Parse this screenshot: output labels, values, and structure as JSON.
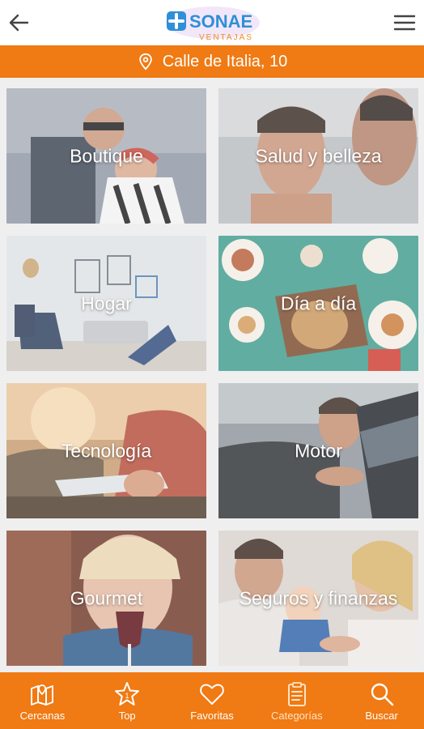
{
  "header": {
    "back_icon": "arrow-left-icon",
    "menu_icon": "hamburger-icon",
    "logo_main": "SONAE",
    "logo_sub": "VENTAJAS"
  },
  "location": {
    "icon": "map-pin-icon",
    "address": "Calle de Italia, 10"
  },
  "categories": [
    {
      "label": "Boutique"
    },
    {
      "label": "Salud y belleza"
    },
    {
      "label": "Hogar"
    },
    {
      "label": "Día a día"
    },
    {
      "label": "Tecnología"
    },
    {
      "label": "Motor"
    },
    {
      "label": "Gourmet"
    },
    {
      "label": "Seguros y finanzas"
    }
  ],
  "bottom_nav": [
    {
      "label": "Cercanas",
      "icon": "map-icon"
    },
    {
      "label": "Top",
      "icon": "star-icon"
    },
    {
      "label": "Favoritas",
      "icon": "heart-icon"
    },
    {
      "label": "Categorías",
      "icon": "clipboard-list-icon",
      "active": true
    },
    {
      "label": "Buscar",
      "icon": "search-icon"
    }
  ],
  "colors": {
    "brand_orange": "#f07a13",
    "logo_blue": "#2f8fd8",
    "logo_orange": "#f28a1e"
  }
}
